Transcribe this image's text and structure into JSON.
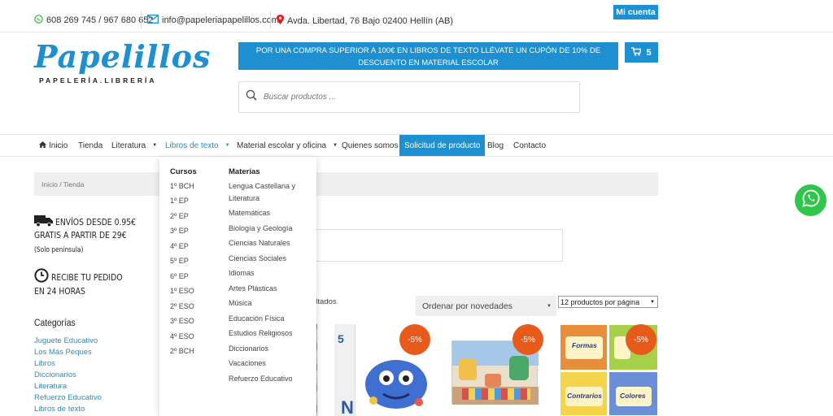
{
  "topbar": {
    "phone": "608 269 745 / 967 680 652",
    "email": "info@papeleriapapelillos.com",
    "address": "Avda. Libertad, 76 Bajo 02400 Hellín (AB)",
    "account_label": "Mi cuenta"
  },
  "logo": {
    "name": "Papelillos",
    "tagline": "PAPELERÍA.LIBRERÍA"
  },
  "promo": {
    "text": "POR UNA COMPRA SUPERIOR A 100€ EN LIBROS DE TEXTO LLÉVATE UN CUPÓN DE 10% DE DESCUENTO EN MATERIAL ESCOLAR"
  },
  "cart": {
    "count": "5"
  },
  "search": {
    "placeholder": "Buscar productos ..."
  },
  "nav": {
    "items": [
      "Inicio",
      "Tienda",
      "Literatura",
      "Libros de texto",
      "Material escolar y oficina",
      "Quienes somos",
      "Solicitud de producto",
      "Blog",
      "Contacto"
    ]
  },
  "breadcrumb": "Inicio / Tienda",
  "sidebar": {
    "shipping_line1": "ENVÍOS DESDE 0.95€",
    "shipping_line2": "GRATIS A PARTIR DE 29€",
    "shipping_note": "(Solo península)",
    "delivery_line1": "RECIBE TU PEDIDO",
    "delivery_line2": "EN 24 HORAS",
    "categories_title": "Categorías",
    "categories": [
      "Juguete Educativo",
      "Los Más Peques",
      "Libros",
      "Diccionarios",
      "Literatura",
      "Refuerzo Educativo",
      "Libros de texto"
    ]
  },
  "dropdown": {
    "cursos_title": "Cursos",
    "cursos": [
      "1º BCH",
      "1º EP",
      "2º EP",
      "3º EP",
      "4º EP",
      "5º EP",
      "6º EP",
      "1º ESO",
      "2º ESO",
      "3º ESO",
      "4º ESO",
      "2º BCH"
    ],
    "materias_title": "Materias",
    "materias_lengua_1": "Lengua Castellana y",
    "materias_lengua_2": "Literatura",
    "materias": [
      "Matemáticas",
      "Biología y Geología",
      "Ciencias Naturales",
      "Ciencias Sociales",
      "Idiomas",
      "Artes Plásticas",
      "Música",
      "Educación Física",
      "Estudios Religiosos",
      "Diccionarios",
      "Vacaciones",
      "Refuerzo Educativo"
    ]
  },
  "shop": {
    "results_fragment": "ultados",
    "order_label": "Ordenar por novedades",
    "per_page_label": "12 productos por página",
    "discount_badge": "-5%",
    "product3_labels": [
      "Formas",
      "Contrarios",
      "Colores"
    ]
  },
  "colors": {
    "brand": "#1e8fd0",
    "badge": "#e85a1a",
    "whatsapp": "#2fc64c"
  }
}
